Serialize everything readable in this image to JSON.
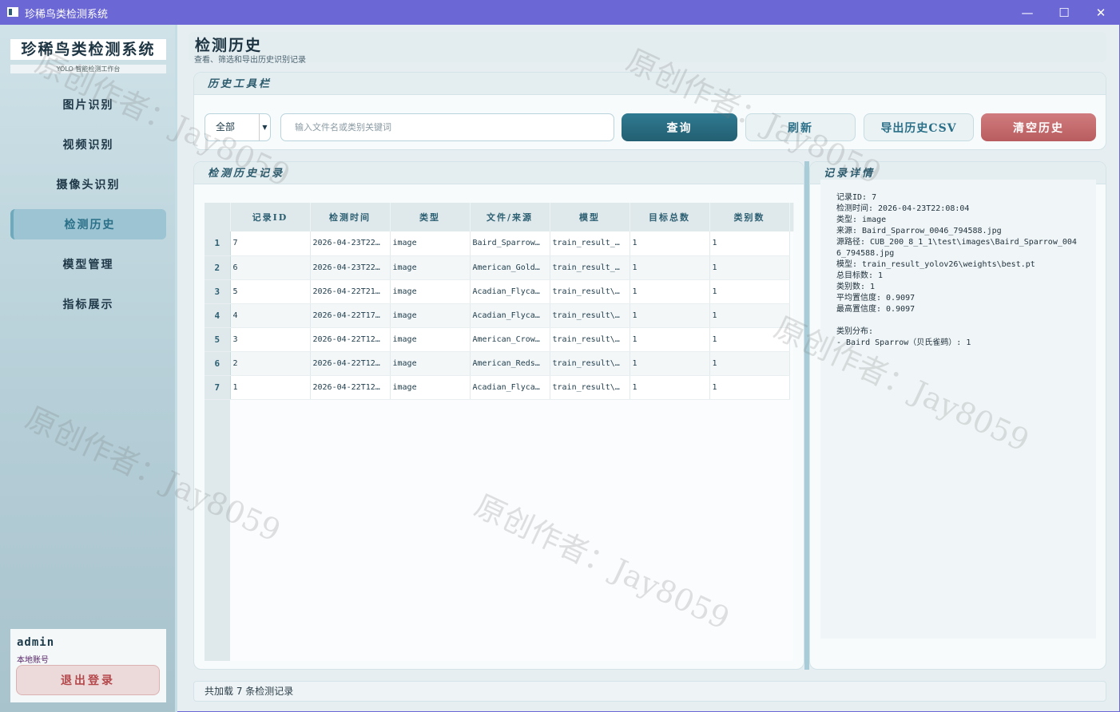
{
  "window": {
    "title": "珍稀鸟类检测系统",
    "minimize": "—",
    "maximize": "☐",
    "close": "✕"
  },
  "sidebar": {
    "brand_title": "珍稀鸟类检测系统",
    "brand_sub": "YOLO 智能检测工作台",
    "items": [
      {
        "label": "图片识别"
      },
      {
        "label": "视频识别"
      },
      {
        "label": "摄像头识别"
      },
      {
        "label": "检测历史",
        "active": true
      },
      {
        "label": "模型管理"
      },
      {
        "label": "指标展示"
      }
    ],
    "user": {
      "name": "admin",
      "role": "本地账号",
      "logout": "退出登录"
    }
  },
  "header": {
    "title": "检测历史",
    "subtitle": "查看、筛选和导出历史识别记录"
  },
  "toolbar": {
    "title": "历史工具栏",
    "filter_value": "全部",
    "search_placeholder": "输入文件名或类别关键词",
    "query": "查询",
    "refresh": "刷新",
    "export": "导出历史CSV",
    "clear": "清空历史"
  },
  "records": {
    "title": "检测历史记录",
    "columns": [
      "记录ID",
      "检测时间",
      "类型",
      "文件/来源",
      "模型",
      "目标总数",
      "类别数"
    ],
    "rows": [
      [
        "1",
        "7",
        "2026-04-23T22…",
        "image",
        "Baird_Sparrow…",
        "train_result_…",
        "1",
        "1"
      ],
      [
        "2",
        "6",
        "2026-04-23T22…",
        "image",
        "American_Gold…",
        "train_result_…",
        "1",
        "1"
      ],
      [
        "3",
        "5",
        "2026-04-22T21…",
        "image",
        "Acadian_Flyca…",
        "train_result\\…",
        "1",
        "1"
      ],
      [
        "4",
        "4",
        "2026-04-22T17…",
        "image",
        "Acadian_Flyca…",
        "train_result\\…",
        "1",
        "1"
      ],
      [
        "5",
        "3",
        "2026-04-22T12…",
        "image",
        "American_Crow…",
        "train_result\\…",
        "1",
        "1"
      ],
      [
        "6",
        "2",
        "2026-04-22T12…",
        "image",
        "American_Reds…",
        "train_result\\…",
        "1",
        "1"
      ],
      [
        "7",
        "1",
        "2026-04-22T12…",
        "image",
        "Acadian_Flyca…",
        "train_result\\…",
        "1",
        "1"
      ]
    ]
  },
  "detail": {
    "title": "记录详情",
    "text": "记录ID: 7\n检测时间: 2026-04-23T22:08:04\n类型: image\n来源: Baird_Sparrow_0046_794588.jpg\n源路径: CUB_200_8_1_1\\test\\images\\Baird_Sparrow_0046_794588.jpg\n模型: train_result_yolov26\\weights\\best.pt\n总目标数: 1\n类别数: 1\n平均置信度: 0.9097\n最高置信度: 0.9097\n\n类别分布:\n- Baird Sparrow（贝氏雀鹀）: 1"
  },
  "status": {
    "text": "共加载 7 条检测记录"
  },
  "watermark": "原创作者：Jay8059",
  "colors": {
    "titlebar": "#6b67d4",
    "primary": "#2b6d82",
    "danger": "#c46a6c",
    "accent": "#9cc4d2"
  }
}
